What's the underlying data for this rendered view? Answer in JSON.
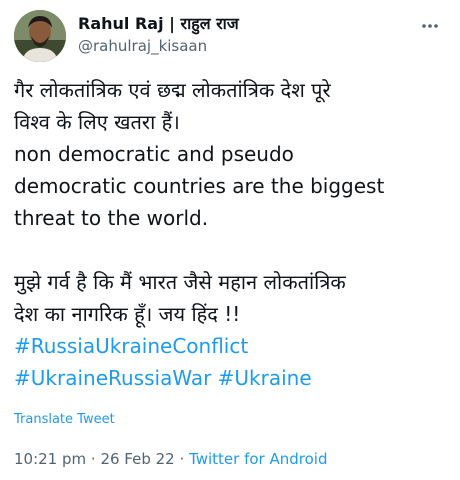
{
  "author": {
    "display_name": "Rahul Raj | राहुल राज",
    "handle": "@rahulraj_kisaan"
  },
  "tweet": {
    "lines_hi_1": [
      "गैर लोकतांत्रिक एवं छद्म लोकतांत्रिक देश पूरे",
      "विश्व के लिए खतरा हैं।"
    ],
    "lines_en": [
      "non democratic and pseudo",
      "democratic countries are the biggest",
      "threat to the world."
    ],
    "lines_hi_2": [
      "मुझे गर्व है कि मैं भारत जैसे महान लोकतांत्रिक",
      "देश का नागरिक हूँ। जय हिंद !!"
    ],
    "hashtags": [
      "#RussiaUkraineConflict",
      "#UkraineRussiaWar",
      "#Ukraine"
    ]
  },
  "translate_label": "Translate Tweet",
  "meta": {
    "time": "10:21 pm",
    "separator": " · ",
    "date": "26 Feb 22",
    "source": "Twitter for Android"
  },
  "colors": {
    "link": "#1d9bf0",
    "muted": "#536471",
    "text": "#0f1419"
  },
  "icons": [
    "more-options-icon",
    "avatar"
  ]
}
